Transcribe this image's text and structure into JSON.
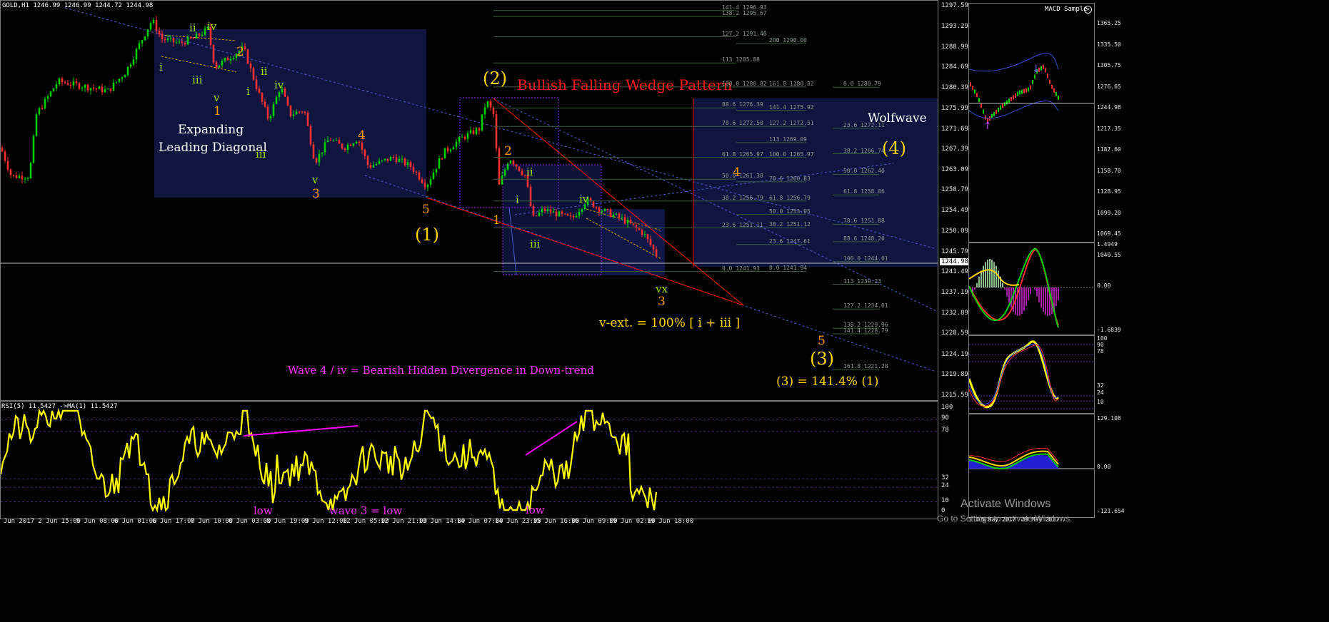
{
  "main_chart": {
    "header": "GOLD,H1  1246.99 1246.99 1244.72 1244.98",
    "current_price": "1244.98",
    "price_scale": [
      "1297.59",
      "1293.29",
      "1288.99",
      "1284.69",
      "1280.39",
      "1275.99",
      "1271.69",
      "1267.39",
      "1263.09",
      "1258.79",
      "1254.49",
      "1250.09",
      "1245.79",
      "1241.49",
      "1237.19",
      "1232.89",
      "1228.59",
      "1224.19",
      "1219.89",
      "1215.59"
    ],
    "time_axis": [
      "1 Jun 2017",
      "2 Jun 15:00",
      "5 Jun 08:00",
      "6 Jun 01:00",
      "6 Jun 17:00",
      "7 Jun 10:00",
      "8 Jun 03:00",
      "8 Jun 19:00",
      "9 Jun 12:00",
      "12 Jun 05:00",
      "12 Jun 21:00",
      "13 Jun 14:00",
      "14 Jun 07:00",
      "14 Jun 23:00",
      "15 Jun 16:00",
      "16 Jun 09:00",
      "19 Jun 02:00",
      "19 Jun 18:00"
    ],
    "annotations": {
      "title": "Bullish Falling Wedge Pattern",
      "expanding": "Expanding",
      "leading_diagonal": "Leading Diagonal",
      "wolfwave": "Wolfwave",
      "wave_2_big": "(2)",
      "wave_1_big": "(1)",
      "wave_3_big": "(3)",
      "wave_4_big": "(4)",
      "v_ext": "v-ext. = 100% [ i + iii ]",
      "target": "(3) = 141.4% (1)",
      "divergence": "Wave 4 / iv = Bearish Hidden Divergence in Down-trend",
      "vx": "vx",
      "w_i": "i",
      "w_ii": "ii",
      "w_iii": "iii",
      "w_iv": "iv",
      "w_v": "v",
      "n1": "1",
      "n2": "2",
      "n3": "3",
      "n4": "4",
      "n5": "5"
    },
    "fib_left": [
      "141.4 1296.93",
      "138.2 1295.67",
      "127.2 1291.40",
      "113 1285.88",
      "100.0 1280.82",
      "88.6 1276.39",
      "78.6 1272.50",
      "61.8 1265.97",
      "50.0 1261.38",
      "38.2 1256.79",
      "23.6 1251.11",
      "0.0 1241.93"
    ],
    "fib_mid": [
      "200 1290.00",
      "161.8 1280.82",
      "141.4 1275.92",
      "127.2 1272.51",
      "113 1269.09",
      "100.0 1265.97",
      "78.6 1260.83",
      "61.8 1256.79",
      "50.0 1253.95",
      "38.2 1251.12",
      "23.6 1247.61",
      "0.0 1241.94"
    ],
    "fib_right": [
      "0.0 1280.79",
      "23.6 1272.11",
      "38.2 1266.74",
      "50.0 1262.40",
      "61.8 1258.06",
      "78.6 1251.88",
      "88.6 1248.20",
      "100.0 1244.01",
      "113 1239.23",
      "127.2 1234.01",
      "138.2 1229.96",
      "141.4 1228.79",
      "161.8 1221.28"
    ]
  },
  "rsi": {
    "header": "RSI(5) 11.5427  ->MA(1) 11.5427",
    "levels": [
      "100",
      "90",
      "78",
      "32",
      "24",
      "10",
      "0"
    ],
    "labels": {
      "low1": "low",
      "wave3": "wave 3 = low",
      "low2": "low"
    }
  },
  "side": {
    "title": "MACD Sample",
    "price_scale": [
      "1365.25",
      "1335.50",
      "1305.75",
      "1276.65",
      "1244.98",
      "1217.35",
      "1187.60",
      "1158.70",
      "1128.95",
      "1099.20",
      "1069.45",
      "1040.55"
    ],
    "current": "1244.98",
    "macd_scale": [
      "1.4949",
      "0.00",
      "-1.6839"
    ],
    "stoch_scale": [
      "100",
      "90",
      "78",
      "32",
      "24",
      "10"
    ],
    "bottom_scale": [
      "129.108",
      "0.00",
      "-121.654"
    ],
    "time": [
      "1 Jun",
      "5 May 2017",
      "29 May 2017"
    ]
  },
  "watermark": {
    "line1": "Activate Windows",
    "line2": "Go to Settings to activate Windows."
  },
  "colors": {
    "bull": "#00d000",
    "bear": "#ff3030",
    "rsi": "#ffff00",
    "wedge": "#ff0000",
    "orange": "#ff9900",
    "yellow": "#ffd700",
    "magenta": "#ff00ff",
    "green_label": "#a0e000"
  }
}
